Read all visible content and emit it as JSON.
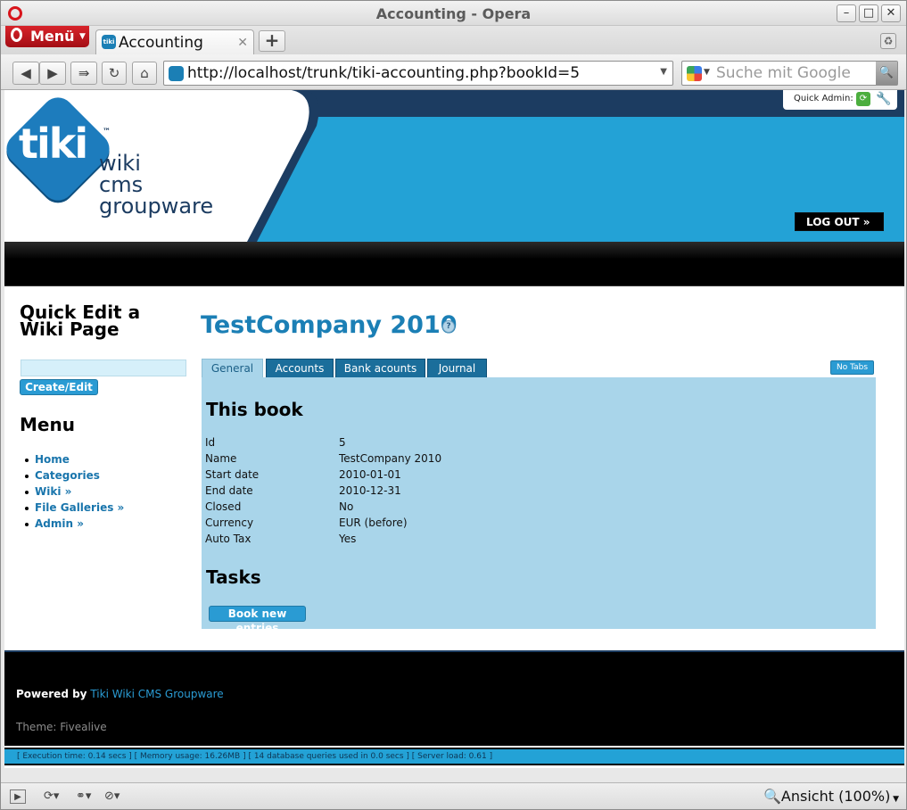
{
  "browser": {
    "window_title": "Accounting - Opera",
    "menu_label": "Menü",
    "tab_title": "Accounting",
    "url": "http://localhost/trunk/tiki-accounting.php?bookId=5",
    "search_placeholder": "Suche mit Google",
    "zoom_label": "Ansicht (100%)"
  },
  "header": {
    "logo_tiki": "tiki",
    "logo_tm": "™",
    "logo_lines": [
      "wiki",
      "cms",
      "groupware"
    ],
    "quick_admin_label": "Quick Admin:",
    "logout_label": "LOG OUT »"
  },
  "left": {
    "quick_edit_title": "Quick Edit a Wiki Page",
    "create_edit_label": "Create/Edit",
    "menu_title": "Menu",
    "menu_items": [
      "Home",
      "Categories",
      "Wiki »",
      "File Galleries »",
      "Admin »"
    ]
  },
  "main": {
    "title": "TestCompany 2010",
    "tabs": [
      "General",
      "Accounts",
      "Bank acounts",
      "Journal"
    ],
    "no_tabs_label": "No Tabs",
    "section_book": "This book",
    "book_rows": [
      {
        "key": "Id",
        "value": "5"
      },
      {
        "key": "Name",
        "value": "TestCompany 2010"
      },
      {
        "key": "Start date",
        "value": "2010-01-01"
      },
      {
        "key": "End date",
        "value": "2010-12-31"
      },
      {
        "key": "Closed",
        "value": "No"
      },
      {
        "key": "Currency",
        "value": "EUR (before)"
      },
      {
        "key": "Auto Tax",
        "value": "Yes"
      }
    ],
    "section_tasks": "Tasks",
    "book_entries_label": "Book new entries"
  },
  "footer": {
    "powered_by": "Powered by",
    "powered_link": "Tiki Wiki CMS Groupware",
    "theme": "Theme: Fivealive",
    "stats": "[ Execution time: 0.14 secs ]   [ Memory usage: 16.26MB ]   [ 14 database queries used in 0.0 secs ]   [ Server load: 0.61 ]"
  },
  "colors": {
    "accent": "#23a2d6",
    "tab_dark": "#1b6e9b",
    "panel": "#a9d5ea",
    "link": "#1975ac"
  }
}
